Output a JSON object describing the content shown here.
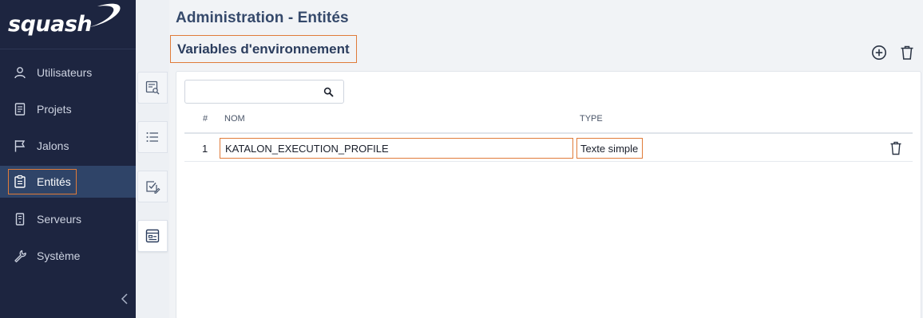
{
  "app": {
    "logo_text": "squash"
  },
  "sidebar": {
    "items": [
      {
        "label": "Utilisateurs",
        "icon": "user-icon"
      },
      {
        "label": "Projets",
        "icon": "document-icon"
      },
      {
        "label": "Jalons",
        "icon": "flag-icon"
      },
      {
        "label": "Entités",
        "icon": "clipboard-icon",
        "active": true
      },
      {
        "label": "Serveurs",
        "icon": "server-icon"
      },
      {
        "label": "Système",
        "icon": "wrench-icon"
      }
    ],
    "collapse_icon": "chevron-left-icon"
  },
  "rail": {
    "items": [
      {
        "icon": "list-search-icon"
      },
      {
        "icon": "bullet-list-icon"
      },
      {
        "icon": "checkbox-edit-icon"
      },
      {
        "icon": "form-icon",
        "active": true
      }
    ]
  },
  "header": {
    "page_title": "Administration - Entités",
    "section_title": "Variables d'environnement",
    "add_icon": "plus-circle-icon",
    "delete_icon": "trash-icon"
  },
  "search": {
    "value": "",
    "placeholder": "",
    "icon": "search-icon"
  },
  "table": {
    "columns": [
      "#",
      "NOM",
      "TYPE"
    ],
    "rows": [
      {
        "index": "1",
        "name": "KATALON_EXECUTION_PROFILE",
        "type": "Texte simple"
      }
    ]
  },
  "colors": {
    "sidebar_bg": "#1d2540",
    "sidebar_active": "#2f4468",
    "highlight": "#e07b39",
    "title": "#35496b"
  }
}
